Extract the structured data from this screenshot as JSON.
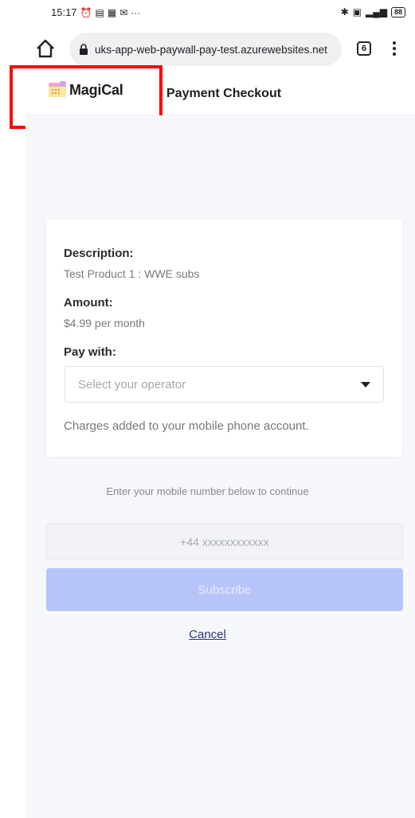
{
  "status_bar": {
    "time": "15:17",
    "battery": "88"
  },
  "browser": {
    "url": "uks-app-web-paywall-pay-test.azurewebsites.net",
    "tab_count": "6"
  },
  "header": {
    "logo_text": "MagiCal",
    "title": "Payment Checkout"
  },
  "checkout": {
    "description_label": "Description:",
    "description_value": "Test Product 1 : WWE subs",
    "amount_label": "Amount:",
    "amount_value": "$4.99 per month",
    "pay_with_label": "Pay with:",
    "operator_placeholder": "Select your operator",
    "charges_note": "Charges added to your mobile phone account."
  },
  "mobile": {
    "hint": "Enter your mobile number below to continue",
    "placeholder": "+44 xxxxxxxxxxxx",
    "subscribe_label": "Subscribe",
    "cancel_label": "Cancel"
  },
  "colors": {
    "highlight": "#ff0000",
    "subscribe_bg": "#b6c4f8",
    "page_bg": "#f6f7fb"
  }
}
